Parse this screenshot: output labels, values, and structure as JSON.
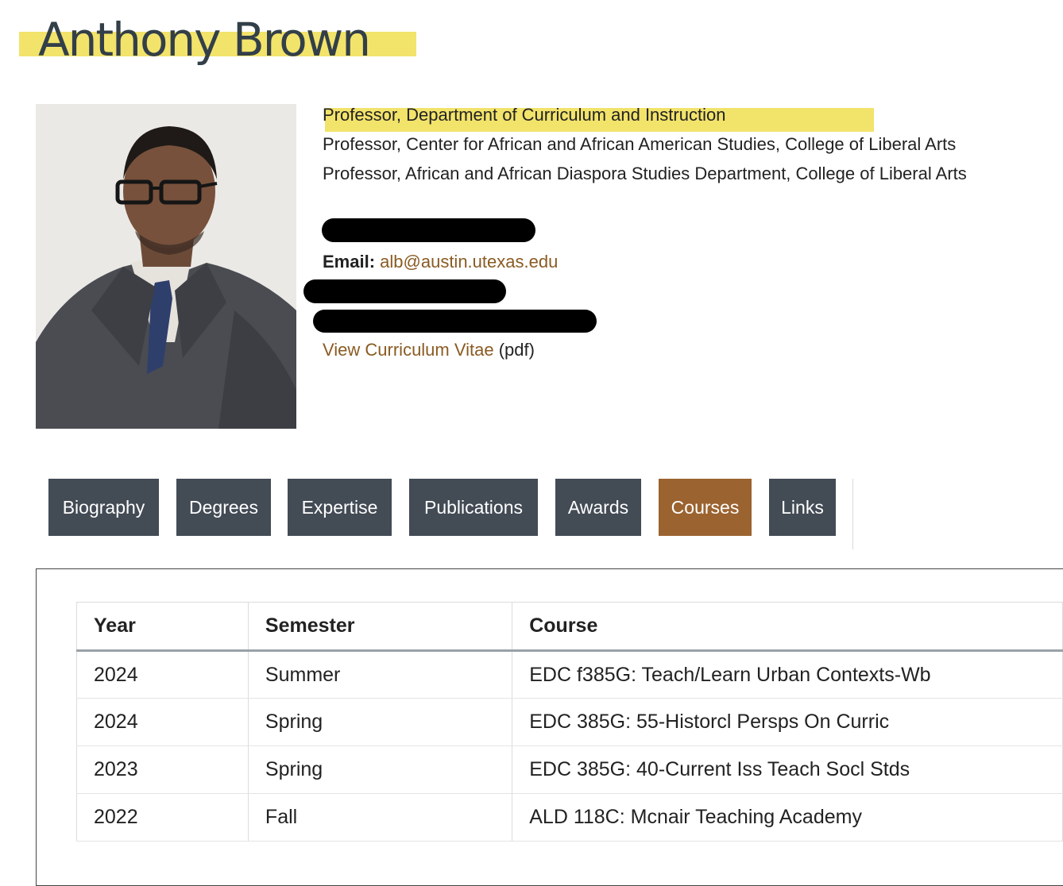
{
  "profile": {
    "name": "Anthony Brown",
    "titles": [
      "Professor, Department of Curriculum and Instruction",
      "Professor, Center for African and African American Studies, College of Liberal Arts",
      "Professor, African and African Diaspora Studies Department, College of Liberal Arts"
    ],
    "email_label": "Email:",
    "email": "alb@austin.utexas.edu",
    "cv_link": "View Curriculum Vitae",
    "cv_suffix": "(pdf)"
  },
  "colors": {
    "highlight": "#f2e36b",
    "tab_bg": "#434b55",
    "tab_active_bg": "#9b6330",
    "link": "#8a5b22"
  },
  "tabs": [
    {
      "label": "Biography"
    },
    {
      "label": "Degrees"
    },
    {
      "label": "Expertise"
    },
    {
      "label": "Publications"
    },
    {
      "label": "Awards"
    },
    {
      "label": "Courses",
      "active": true
    },
    {
      "label": "Links"
    }
  ],
  "courses": {
    "headers": [
      "Year",
      "Semester",
      "Course"
    ],
    "rows": [
      [
        "2024",
        "Summer",
        "EDC f385G: Teach/Learn Urban Contexts-Wb"
      ],
      [
        "2024",
        "Spring",
        "EDC 385G: 55-Historcl Persps On Curric"
      ],
      [
        "2023",
        "Spring",
        "EDC 385G: 40-Current Iss Teach Socl Stds"
      ],
      [
        "2022",
        "Fall",
        "ALD 118C: Mcnair Teaching Academy"
      ]
    ]
  }
}
